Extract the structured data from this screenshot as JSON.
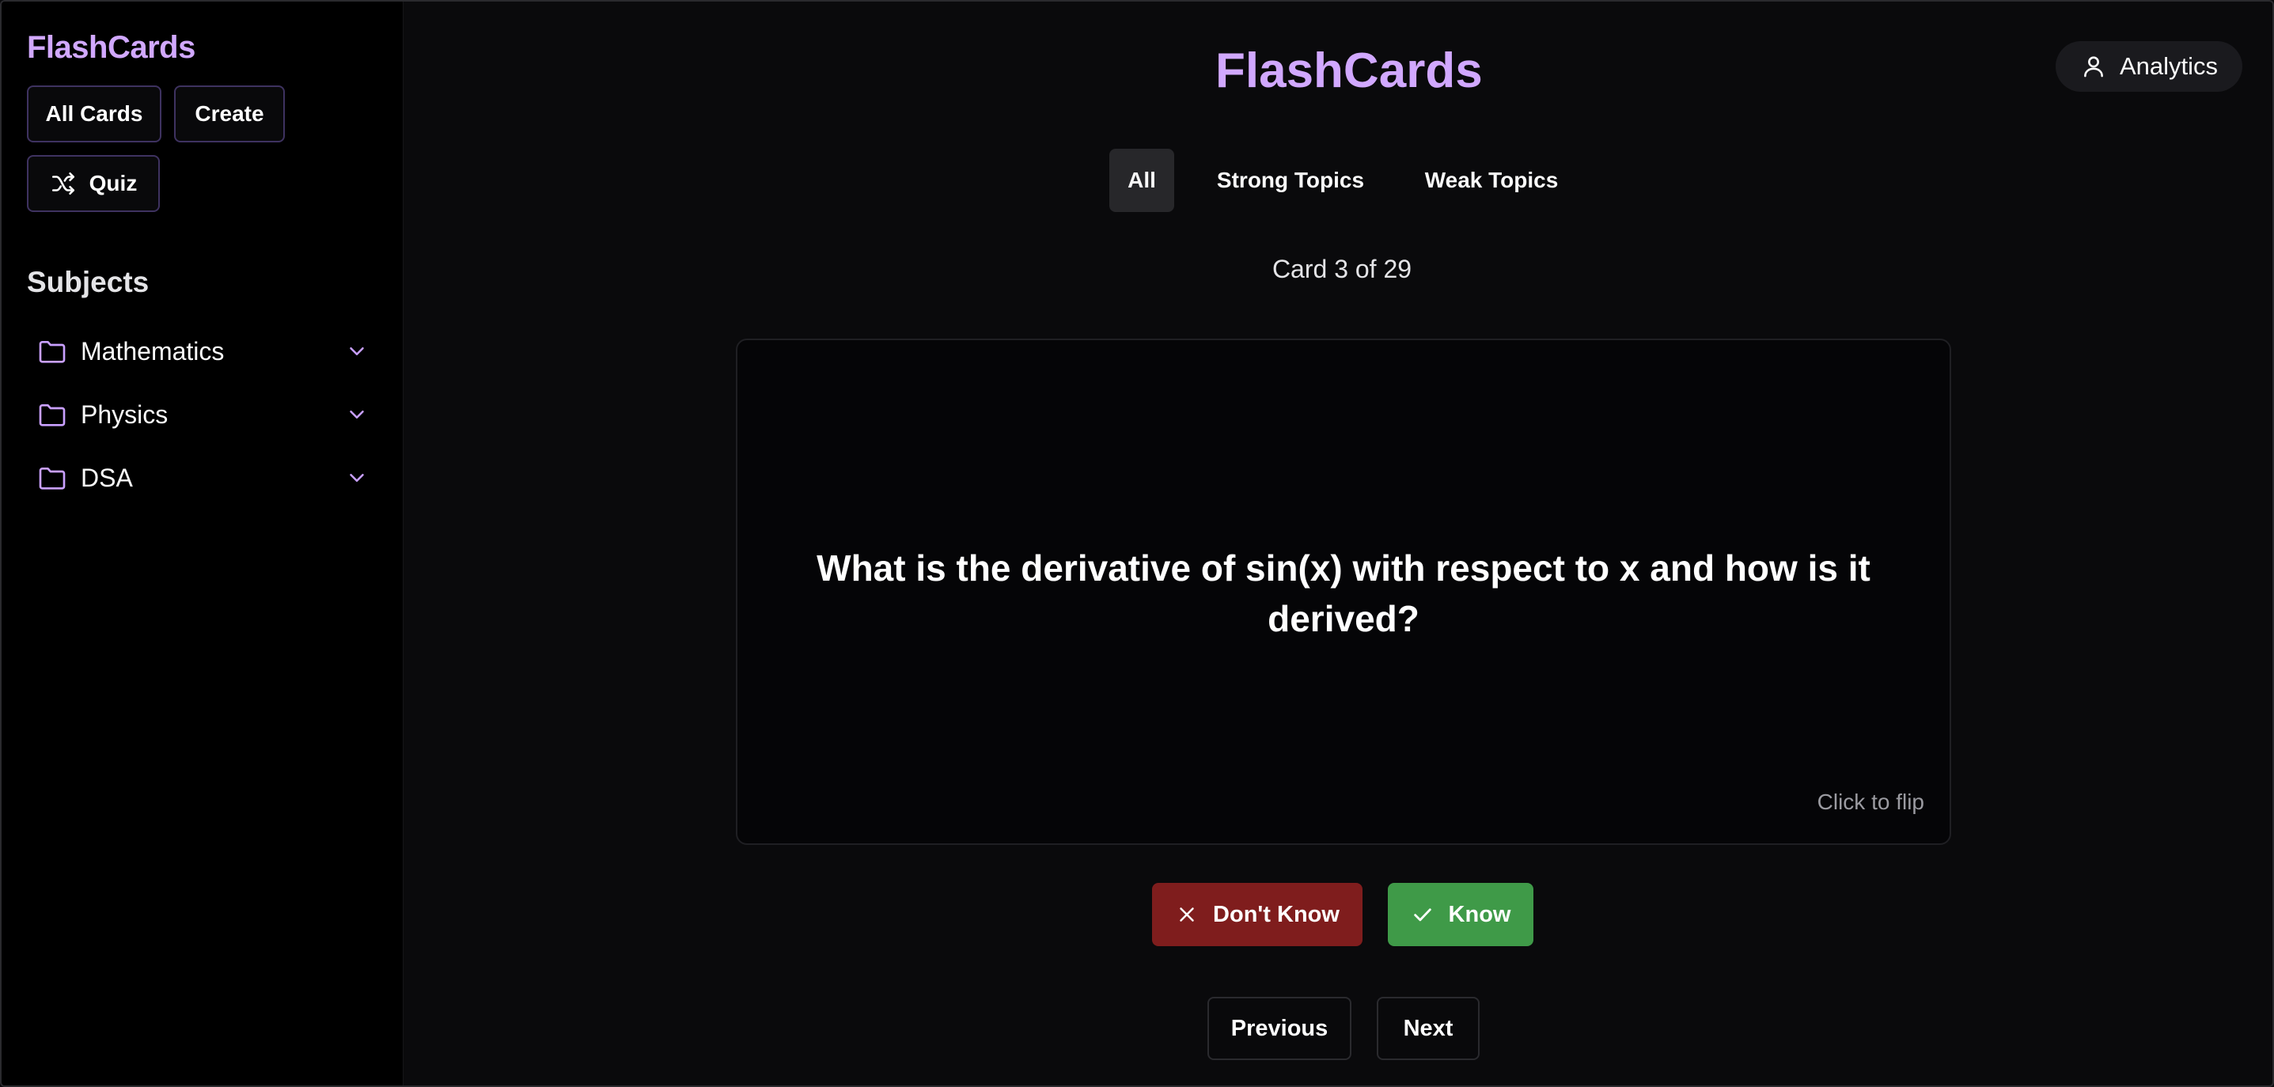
{
  "sidebar": {
    "brand": "FlashCards",
    "nav": {
      "all_cards": "All Cards",
      "create": "Create",
      "quiz": "Quiz"
    },
    "subjects_title": "Subjects",
    "subjects": [
      {
        "label": "Mathematics",
        "icon": "folder-icon"
      },
      {
        "label": "Physics",
        "icon": "folder-icon"
      },
      {
        "label": "DSA",
        "icon": "folder-icon"
      }
    ]
  },
  "header": {
    "title": "FlashCards",
    "analytics_label": "Analytics"
  },
  "tabs": [
    {
      "label": "All",
      "active": true
    },
    {
      "label": "Strong Topics",
      "active": false
    },
    {
      "label": "Weak Topics",
      "active": false
    }
  ],
  "counter": "Card 3 of 29",
  "card": {
    "question": "What is the derivative of sin(x) with respect to x and how is it derived?",
    "flip_hint": "Click to flip"
  },
  "actions": {
    "dont_know": "Don't Know",
    "know": "Know"
  },
  "pager": {
    "previous": "Previous",
    "next": "Next"
  },
  "colors": {
    "accent": "#d1a8ff",
    "dont_know_bg": "#7f1d1d",
    "know_bg": "#3f9a48",
    "background": "#0a0a0c",
    "sidebar_bg": "#000000"
  }
}
